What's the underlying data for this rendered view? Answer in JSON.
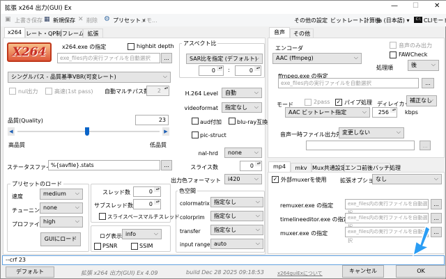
{
  "window": {
    "title": "拡張 x264 出力(GUI) Ex",
    "minimize": "—",
    "maximize": "☐",
    "close": "✕"
  },
  "toolbar": {
    "overwrite_save": "上書き保存",
    "new_save": "新規保存",
    "delete": "削除",
    "preset": "プリセット ▾",
    "memo": "メモ...",
    "other_settings": "その他の設定",
    "bitrate_calc": "ビットレート計算機",
    "language": "ja (日本語) ▾",
    "cli_mode": "CLIモード",
    "cli_icon_text": "C:\\"
  },
  "left_tabs": [
    "x264",
    "レート・QP制御",
    "フレーム",
    "拡張"
  ],
  "x264": {
    "logo": "X264",
    "exe_label": "x264.exe の指定",
    "highbit": "highbit depth",
    "exe_placeholder": "exe_files内の実行ファイルを自動選択",
    "browse": "...",
    "aspect": {
      "title": "アスペクト比",
      "mode": "SAR比を指定 (デフォルト)",
      "w": "0",
      "sep": ":",
      "h": "0"
    },
    "mode": "シングルパス - 品質基準VBR(可変レート)",
    "nul": "nul出力",
    "fast": "高速(1st pass)",
    "auto_multipass": "自動マルチパス数",
    "auto_multipass_val": "2",
    "quality_label": "品質(Quality)",
    "quality": "23",
    "quality_fraction": 0.49,
    "high_q": "高品質",
    "low_q": "低品質",
    "status_label": "ステータスファイル",
    "status_file": "%{savfile}.stats",
    "preset": {
      "title": "プリセットのロード",
      "speed_label": "速度",
      "speed": "medium",
      "tune_label": "チューニング",
      "tune": "none",
      "profile_label": "プロファイル",
      "profile": "high",
      "load": "GUIにロード"
    },
    "threads": {
      "label": "スレッド数",
      "value": "0",
      "sub_label": "サブスレッド数",
      "sub_value": "0",
      "slice_based": "スライスベースマルチスレッド"
    },
    "log": {
      "label": "ログ表示",
      "value": "info",
      "psnr": "PSNR",
      "ssim": "SSIM"
    },
    "level_label": "H.264 Level",
    "level": "自動",
    "videoformat_label": "videoformat",
    "videoformat": "指定なし",
    "aud": "aud付加",
    "bluray": "blu-ray互換",
    "picstruct": "pic-struct",
    "nalhrd_label": "nal-hrd",
    "nalhrd": "none",
    "slices_label": "スライス数",
    "slices": "0",
    "csp_label": "出力色フォーマット",
    "csp": "i420",
    "colorspace": {
      "title": "色空間",
      "matrix_label": "colormatrix",
      "matrix": "指定なし",
      "prim_label": "colorprim",
      "prim": "指定なし",
      "transfer_label": "transfer",
      "transfer": "指定なし",
      "range_label": "input range",
      "range": "auto"
    }
  },
  "audio_tabs": [
    "音声",
    "その他"
  ],
  "audio": {
    "encoder_label": "エンコーダ",
    "encoder": "AAC (ffmpeg)",
    "only_audio": "音声のみ出力",
    "faw": "FAWCheck",
    "order_label": "処理順",
    "order": "後",
    "ffmpeg_label": "ffmpeg.exe の指定",
    "ffmpeg_placeholder": "exe_files内の実行ファイルを自動選択",
    "mode_label": "モード",
    "twopass": "2pass",
    "pipe": "パイプ処理",
    "delay_label": "ディレイカット",
    "delay": "補正なし",
    "mode": "AAC ビットレート指定",
    "bitrate": "256",
    "kbps": "kbps",
    "temp_label": "音声一時ファイル出力先",
    "temp": "変更しない",
    "temp_path": ""
  },
  "mux_tabs": [
    "mp4",
    "mkv",
    "Mux共通設定",
    "エンコ前後バッチ処理"
  ],
  "mux": {
    "external": "外部muxerを使用",
    "ext_opt_label": "拡張オプション",
    "ext_opt": "なし",
    "remuxer_label": "remuxer.exe の指定",
    "timeline_label": "timelineeditor.exe の指定",
    "muxer_label": "muxer.exe の指定",
    "placeholder": "exe_files内の実行ファイルを自動選択"
  },
  "cmdline": "--crf 23",
  "footer": {
    "default": "デフォルト",
    "version": "拡張 x264 出力(GUI) Ex 4.09",
    "build": "build Dec 28 2025 09:18:53",
    "about": "x264guiExについて",
    "cancel": "キャンセル",
    "ok": "OK"
  },
  "colors": {
    "accent_arrow": "#2a9df4",
    "slider_thumb": "#0a64c8"
  }
}
